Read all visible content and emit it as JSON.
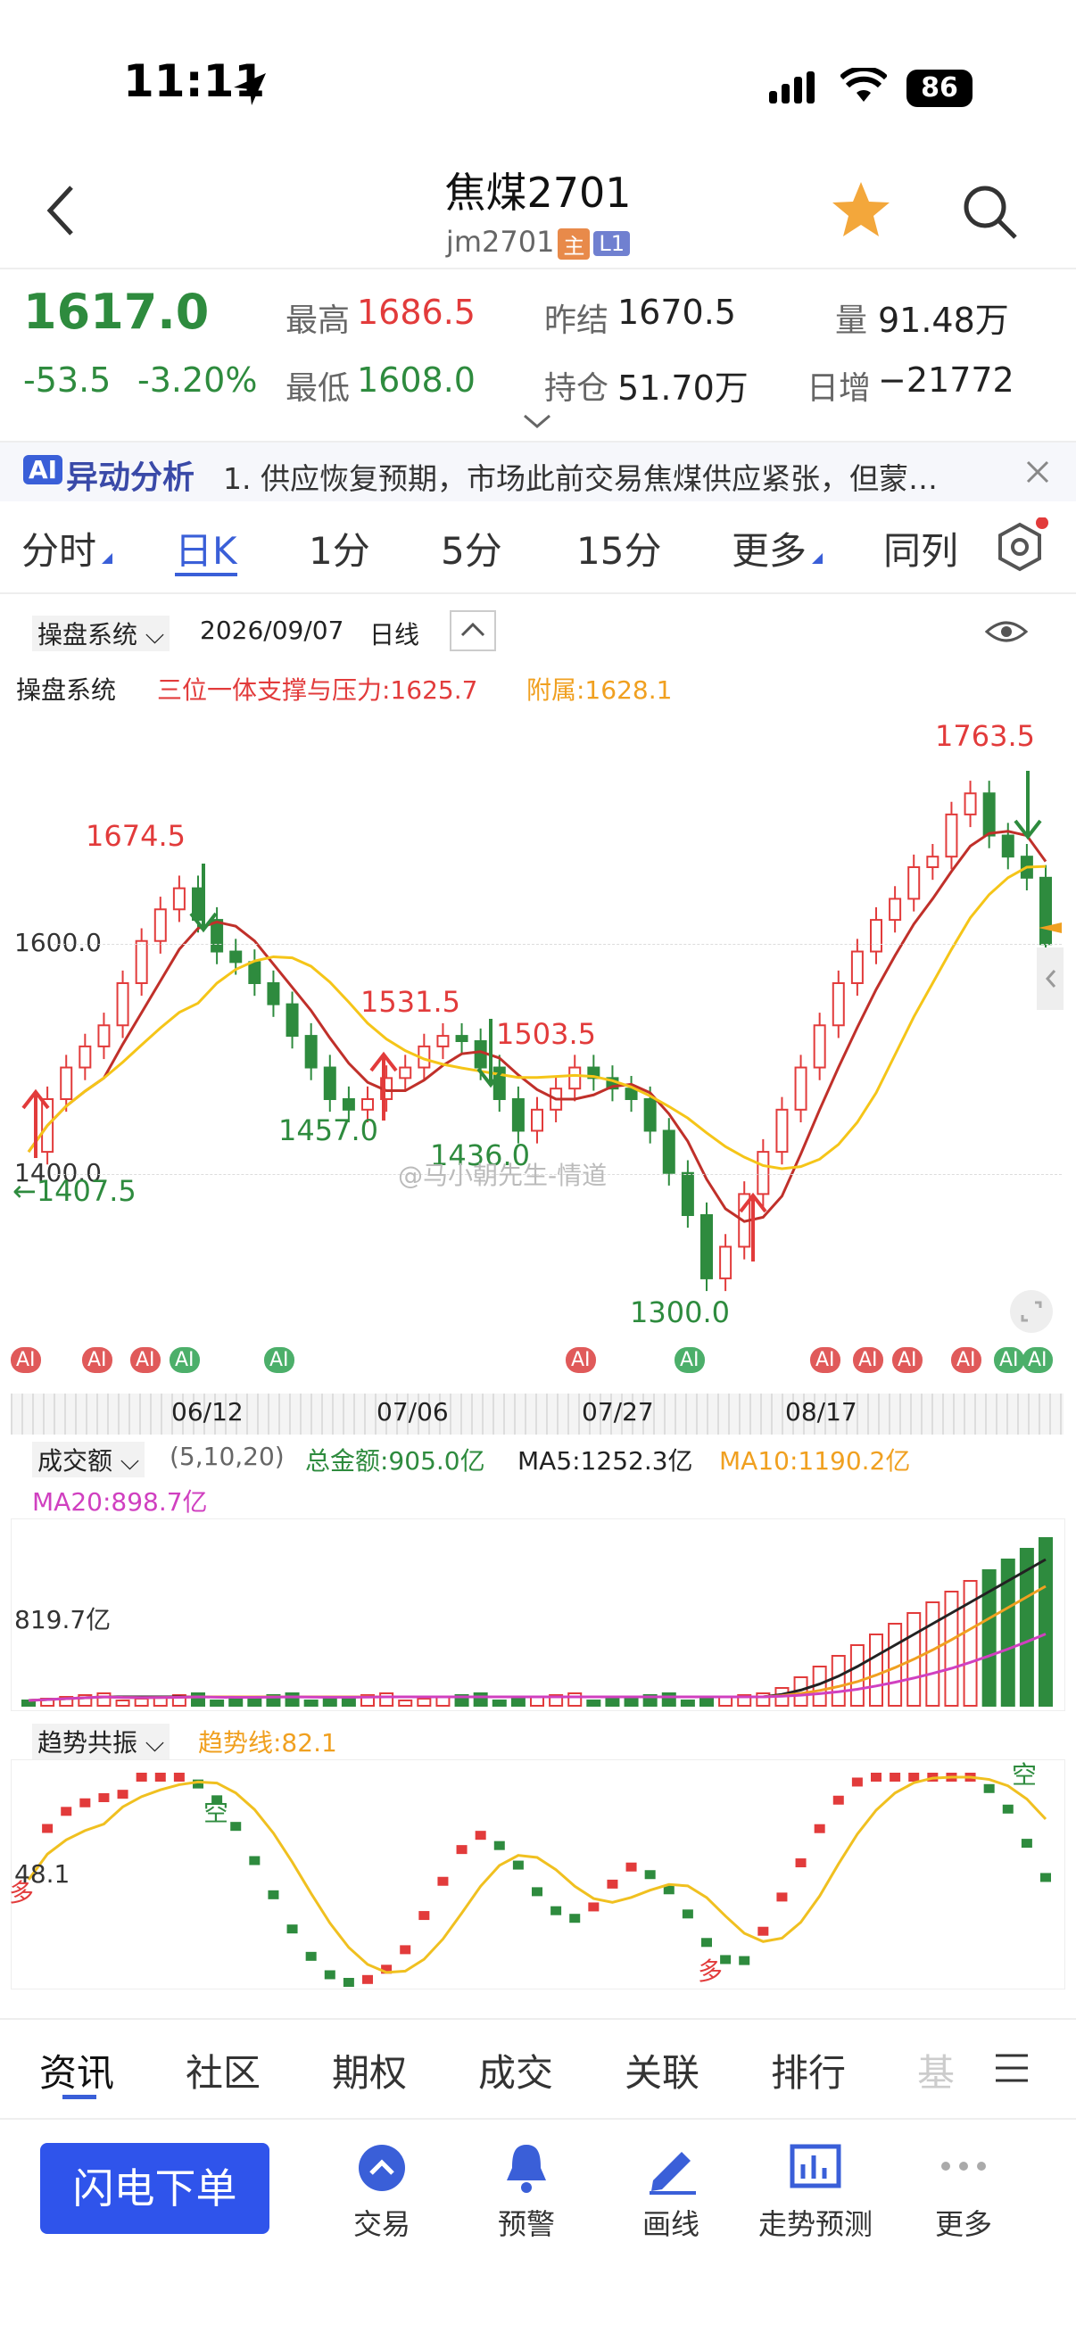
{
  "status": {
    "time": "11:11",
    "battery": "86"
  },
  "header": {
    "title": "焦煤2701",
    "code": "jm2701",
    "tag_main": "主",
    "tag_level": "L1"
  },
  "quote": {
    "price": "1617.0",
    "change": "-53.5",
    "change_pct": "-3.20%",
    "high_label": "最高",
    "high": "1686.5",
    "low_label": "最低",
    "low": "1608.0",
    "prev_settle_label": "昨结",
    "prev_settle": "1670.5",
    "open_int_label": "持仓",
    "open_int": "51.70万",
    "volume_label": "量",
    "volume": "91.48万",
    "daily_inc_label": "日增",
    "daily_inc": "−21772"
  },
  "ticker": {
    "badge": "AI",
    "title": "异动分析",
    "text": "1. 供应恢复预期，市场此前交易焦煤供应紧张，但蒙…"
  },
  "tabs": [
    "分时",
    "日K",
    "1分",
    "5分",
    "15分",
    "更多",
    "同列"
  ],
  "chart_header": {
    "system": "操盘系统",
    "date": "2026/09/07",
    "period": "日线"
  },
  "indicator": {
    "name": "操盘系统",
    "support_label": "三位一体支撑与压力:1625.7",
    "attach_label": "附属:1628.1"
  },
  "price_labels": {
    "hi": "1763.5",
    "a": "1674.5",
    "b": "1531.5",
    "c": "1503.5",
    "d": "1457.0",
    "e": "1436.0",
    "f": "1300.0",
    "g": "←1407.5",
    "y1600": "1600.0",
    "y1400": "1400.0"
  },
  "watermark": "@马小朝先生-情道",
  "dates": [
    "06/12",
    "07/06",
    "07/27",
    "08/17"
  ],
  "volume_panel": {
    "name": "成交额",
    "params": "(5,10,20)",
    "total": "总金额:905.0亿",
    "ma5": "MA5:1252.3亿",
    "ma10": "MA10:1190.2亿",
    "ma20": "MA20:898.7亿",
    "axis": "819.7亿"
  },
  "trend_panel": {
    "name": "趋势共振",
    "line": "趋势线:82.1",
    "axis": "48.1",
    "kong1": "空",
    "kong2": "空",
    "duo1": "多",
    "duo2": "多"
  },
  "ai_marker": "AI",
  "bottom_tabs": [
    "资讯",
    "社区",
    "期权",
    "成交",
    "关联",
    "排行",
    "基"
  ],
  "toolbar": {
    "flash": "闪电下单",
    "items": [
      "交易",
      "预警",
      "画线",
      "走势预测",
      "更多"
    ]
  },
  "colors": {
    "up": "#e23b3b",
    "down": "#2e8b3e",
    "accent": "#3a5fd8",
    "ma10": "#f0a020",
    "ma20": "#d040c0"
  }
}
